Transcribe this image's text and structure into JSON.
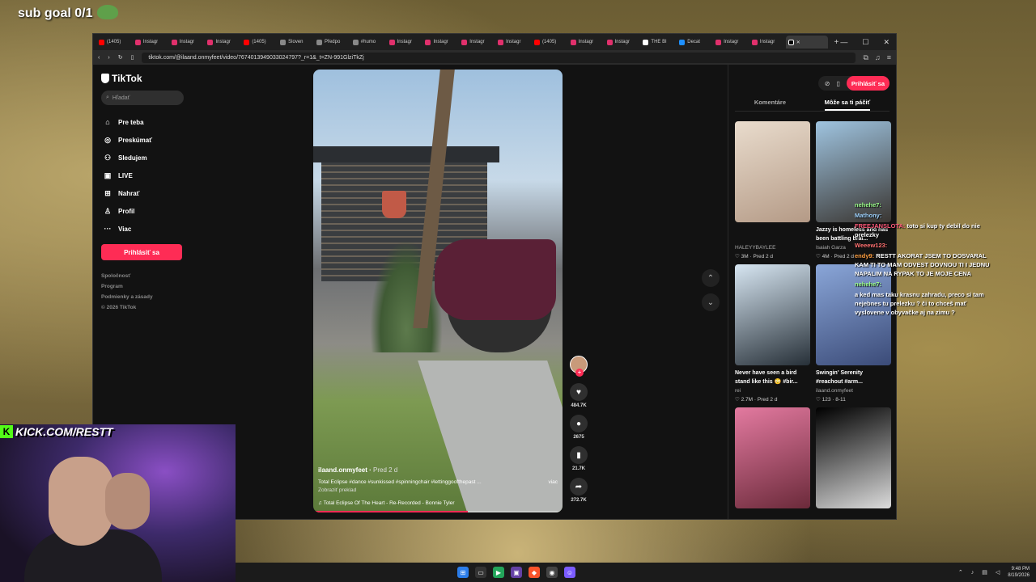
{
  "overlay": {
    "sub_goal": "sub goal 0/1",
    "kick_label": "KICK.COM/RESTT"
  },
  "browser": {
    "tabs": [
      {
        "label": "(1405)",
        "fav": "#ff0000"
      },
      {
        "label": "Instagr",
        "fav": "#e1306c"
      },
      {
        "label": "Instagr",
        "fav": "#e1306c"
      },
      {
        "label": "Instagr",
        "fav": "#e1306c"
      },
      {
        "label": "(1405)",
        "fav": "#ff0000"
      },
      {
        "label": "Sloven",
        "fav": "#888888"
      },
      {
        "label": "Předpo",
        "fav": "#888888"
      },
      {
        "label": "#humo",
        "fav": "#888888"
      },
      {
        "label": "Instagr",
        "fav": "#e1306c"
      },
      {
        "label": "Instagr",
        "fav": "#e1306c"
      },
      {
        "label": "Instagr",
        "fav": "#e1306c"
      },
      {
        "label": "Instagr",
        "fav": "#e1306c"
      },
      {
        "label": "(1405)",
        "fav": "#ff0000"
      },
      {
        "label": "Instagr",
        "fav": "#e1306c"
      },
      {
        "label": "Instagr",
        "fav": "#e1306c"
      },
      {
        "label": "THE Bl",
        "fav": "#ffffff"
      },
      {
        "label": "Decat",
        "fav": "#1e90ff"
      },
      {
        "label": "Instagr",
        "fav": "#e1306c"
      },
      {
        "label": "Instagr",
        "fav": "#e1306c"
      }
    ],
    "url": "tiktok.com/@ilaand.onmyfeet/video/7674013949033024797?_r=1&_t=ZN-991GlziTkZj"
  },
  "tiktok": {
    "logo": "TikTok",
    "search_placeholder": "Hľadať",
    "nav": [
      {
        "icon": "⌂",
        "label": "Pre teba"
      },
      {
        "icon": "◎",
        "label": "Preskúmať"
      },
      {
        "icon": "⚇",
        "label": "Sledujem"
      },
      {
        "icon": "▣",
        "label": "LIVE"
      },
      {
        "icon": "⊞",
        "label": "Nahrať"
      },
      {
        "icon": "♙",
        "label": "Profil"
      },
      {
        "icon": "···",
        "label": "Viac"
      }
    ],
    "login_label": "Prihlásiť sa",
    "footer": [
      "Spoločnosť",
      "Program",
      "Podmienky a zásady",
      "© 2026 TikTok"
    ],
    "video": {
      "username": "ilaand.onmyfeet",
      "date": "Pred 2 d",
      "description": "Total Eclipse #dance #sunkissed #spinningchair #lettinggoofthepast ...",
      "more": "viac",
      "show_translation": "Zobraziť preklad",
      "music": "♫  Total Eclipse Of The Heart - Re-Recorded - Bonnie Tyler",
      "progress": 0.62
    },
    "actions": {
      "likes": "484.7K",
      "comments": "2675",
      "saves": "21.7K",
      "shares": "272.7K"
    },
    "panel": {
      "login_label": "Prihlásiť sa",
      "tabs": [
        "Komentáre",
        "Môže sa ti páčiť"
      ],
      "cards": [
        {
          "title": "",
          "author": "HALEYYBAYLEE",
          "views": "3M",
          "date": "Pred 2 d",
          "colors": [
            "#e9dccd",
            "#b49a86"
          ]
        },
        {
          "title": "Jazzy is homeless and has been battling brai...",
          "author": "Isaiah Garza",
          "views": "4M",
          "date": "Pred 2 d",
          "colors": [
            "#9fc4e0",
            "#3a3632"
          ]
        },
        {
          "title": "Never have seen a bird stand like this 😳 #bir...",
          "author": "rei",
          "views": "2.7M",
          "date": "Pred 2 d",
          "colors": [
            "#d7e6f2",
            "#273038"
          ]
        },
        {
          "title": "Swingin' Serenity #reachout #arm...",
          "author": "ilaand.onmyfeet",
          "views": "123",
          "date": "8-11",
          "colors": [
            "#8aa6d8",
            "#3b4b78"
          ]
        },
        {
          "title": "",
          "author": "",
          "views": "",
          "date": "",
          "colors": [
            "#e37aa0",
            "#6b2a3a"
          ]
        },
        {
          "title": "",
          "author": "",
          "views": "",
          "date": "",
          "colors": [
            "#000000",
            "#dcdcdc"
          ]
        }
      ]
    }
  },
  "chat": [
    {
      "name": "nehehe7:",
      "color": "#9cff8a",
      "text": ""
    },
    {
      "name": "Mathony:",
      "color": "#9fd3ff",
      "text": ""
    },
    {
      "name": "FREEJANSLOTA:",
      "color": "#ff5a7a",
      "text": "toto si kup ty debil do nie prelezky"
    },
    {
      "name": "Weeew123:",
      "color": "#ff7070",
      "text": ""
    },
    {
      "name": "endy9:",
      "color": "#ff9f40",
      "text": "RESTT AKORAT JSEM TO DOSVARAL KAM TI TO MAM ODVEST DOVNOU TI I JEDNU NAPALIM NA RYPAK TO JE MOJE CENA"
    },
    {
      "name": "nehehe7:",
      "color": "#9cff8a",
      "text": ""
    },
    {
      "name": "",
      "color": "#ff7070",
      "text": "a ked mas taku krasnu zahradu, preco si tam nejebnes tu prelezku ? či to chceš mať vyslovene v obyvačke aj na zimu ?"
    }
  ],
  "taskbar": {
    "time": "9:48 PM",
    "date": "8/19/2026"
  }
}
